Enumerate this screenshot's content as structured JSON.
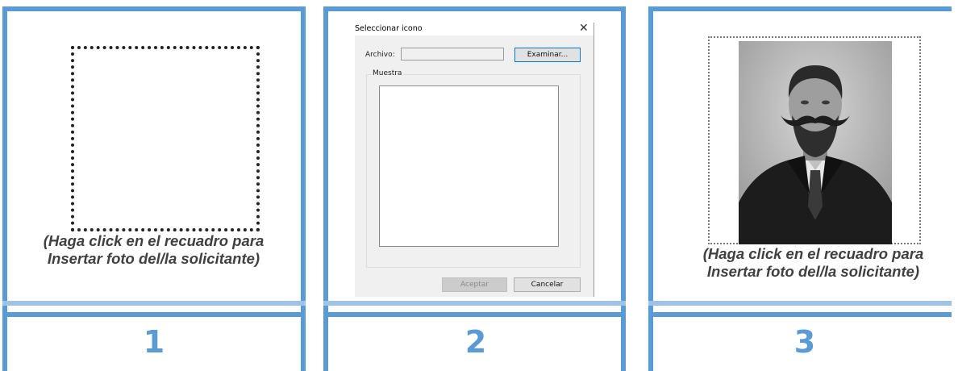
{
  "panels": [
    {
      "number": "1",
      "caption_line1": "(Haga click en el recuadro para",
      "caption_line2": "Insertar foto del/la solicitante)"
    },
    {
      "number": "2",
      "dialog": {
        "title": "Seleccionar icono",
        "close_icon": "close-icon",
        "file_label": "Archivo:",
        "file_value": "",
        "browse_button": "Examinar...",
        "group_label": "Muestra",
        "ok_button": "Aceptar",
        "ok_enabled": false,
        "cancel_button": "Cancelar"
      }
    },
    {
      "number": "3",
      "caption_line1": "(Haga click en el recuadro para",
      "caption_line2": "Insertar foto del/la solicitante)",
      "photo_icon": "person-photo"
    }
  ],
  "colors": {
    "accent_blue": "#5b9bd5",
    "light_blue": "#9dc3e6",
    "caption_text": "#404040",
    "dialog_bg": "#f0f0f0"
  }
}
